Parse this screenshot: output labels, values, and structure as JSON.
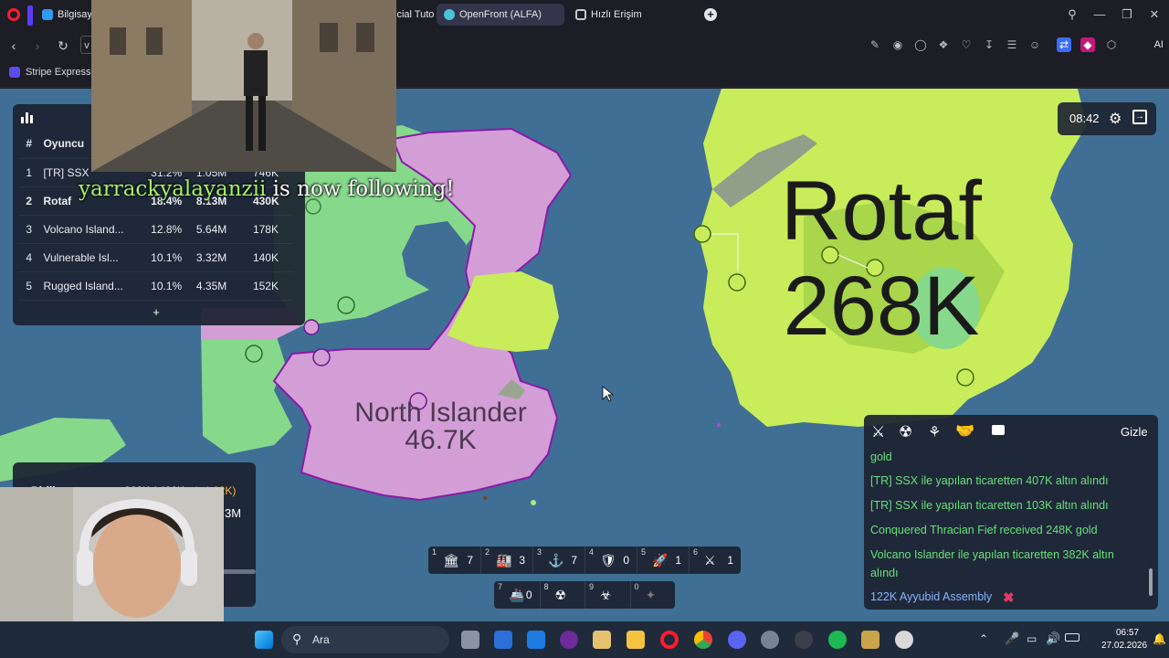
{
  "browser": {
    "tabs": [
      {
        "label": "Bilgisayar",
        "color": "#2e9cf3"
      },
      {
        "label": "icial Tuto",
        "color": "#f0f0f0"
      },
      {
        "label": "OpenFront (ALFA)",
        "color": "#4cc3d9"
      },
      {
        "label": "Hızlı Erişim",
        "color": "#c8c8d2"
      }
    ],
    "new_tab_icon": "plus-icon",
    "address_short": "v",
    "ai_label": "AI",
    "bookmark": "Stripe Express"
  },
  "leaderboard": {
    "columns": [
      "#",
      "Oyuncu",
      "",
      "",
      ""
    ],
    "rows": [
      {
        "rank": "1",
        "name": "[TR] SSX",
        "land": "31.2%",
        "gold": "1.05M",
        "troops": "746K",
        "me": false
      },
      {
        "rank": "2",
        "name": "Rotaf",
        "land": "18.4%",
        "gold": "8.13M",
        "troops": "430K",
        "me": true
      },
      {
        "rank": "3",
        "name": "Volcano Island...",
        "land": "12.8%",
        "gold": "5.64M",
        "troops": "178K",
        "me": false
      },
      {
        "rank": "4",
        "name": "Vulnerable Isl...",
        "land": "10.1%",
        "gold": "3.32M",
        "troops": "140K",
        "me": false
      },
      {
        "rank": "5",
        "name": "Rugged Island...",
        "land": "10.1%",
        "gold": "4.35M",
        "troops": "152K",
        "me": false
      }
    ],
    "expand_label": "+"
  },
  "stream": {
    "follow_user": "yarrackyalayanzii",
    "follow_text": " is now following!"
  },
  "map": {
    "player_label": {
      "name": "Rotaf",
      "troops": "268K"
    },
    "enemy_label": {
      "name": "North Islander",
      "troops": "46.7K"
    },
    "colors": {
      "sea": "#3f6f95",
      "player": "#c9ec5b",
      "player_dark": "#a9d64a",
      "enemy": "#d39ed6",
      "enemy_border": "#8a1aa8",
      "green": "#86d98a",
      "rock": "#8f9f8a"
    }
  },
  "hud": {
    "time": "08:42",
    "settings_icon": "gear-icon",
    "exit_icon": "exit-icon"
  },
  "events": {
    "hide_label": "Gizle",
    "lines": [
      {
        "text": "gold",
        "type": "gain"
      },
      {
        "text": "[TR] SSX ile yapılan ticaretten 407K altın alındı",
        "type": "gain"
      },
      {
        "text": "[TR] SSX ile yapılan ticaretten 103K altın alındı",
        "type": "gain"
      },
      {
        "text": "Conquered Thracian Fief received 248K gold",
        "type": "gain"
      },
      {
        "text": "Volcano Islander ile yapılan ticaretten 382K altın alındı",
        "type": "gain"
      },
      {
        "text": "122K Ayyubid Assembly",
        "type": "info"
      }
    ]
  },
  "goldpanel": {
    "label": "Birlik",
    "troops": "268K / 430K",
    "rate": "(+4.62K)",
    "gold": "3M"
  },
  "build_bar": {
    "row1": [
      {
        "key": "1",
        "icon": "city-icon",
        "count": "7"
      },
      {
        "key": "2",
        "icon": "factory-icon",
        "count": "3"
      },
      {
        "key": "3",
        "icon": "port-icon",
        "count": "7"
      },
      {
        "key": "4",
        "icon": "defense-post-icon",
        "count": "0"
      },
      {
        "key": "5",
        "icon": "missile-silo-icon",
        "count": "1"
      },
      {
        "key": "6",
        "icon": "sam-launcher-icon",
        "count": "1"
      }
    ],
    "row2": [
      {
        "key": "7",
        "icon": "warship-icon",
        "count": "0"
      },
      {
        "key": "8",
        "icon": "atom-bomb-icon",
        "count": ""
      },
      {
        "key": "9",
        "icon": "hydrogen-bomb-icon",
        "count": ""
      },
      {
        "key": "0",
        "icon": "mirv-icon",
        "count": ""
      }
    ]
  },
  "taskbar": {
    "search_placeholder": "Ara",
    "time": "06:57",
    "date": "27.02.2026"
  }
}
